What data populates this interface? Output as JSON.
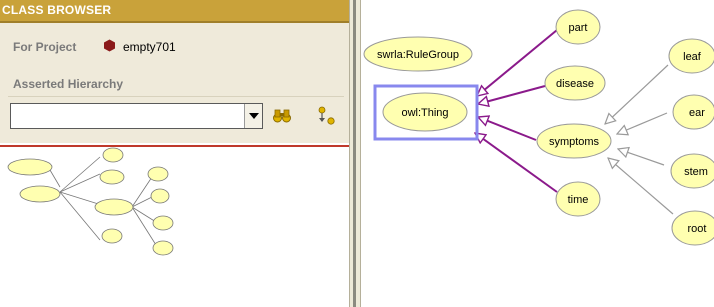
{
  "class_browser": {
    "title": "CLASS BROWSER",
    "project_label": "For Project",
    "project_name": "empty701",
    "hierarchy_label": "Asserted Hierarchy",
    "search": {
      "value": "",
      "placeholder": ""
    }
  },
  "graph": {
    "nodes": [
      {
        "id": "rulegroup",
        "label": "swrla:RuleGroup"
      },
      {
        "id": "thing",
        "label": "owl:Thing",
        "selected": true
      },
      {
        "id": "part",
        "label": "part"
      },
      {
        "id": "disease",
        "label": "disease"
      },
      {
        "id": "symptoms",
        "label": "symptoms"
      },
      {
        "id": "time",
        "label": "time"
      },
      {
        "id": "leaf",
        "label": "leaf"
      },
      {
        "id": "ear",
        "label": "ear"
      },
      {
        "id": "stem",
        "label": "stem"
      },
      {
        "id": "root",
        "label": "root"
      }
    ],
    "edges": [
      {
        "from": "part",
        "to": "thing",
        "style": "primary"
      },
      {
        "from": "disease",
        "to": "thing",
        "style": "primary"
      },
      {
        "from": "symptoms",
        "to": "thing",
        "style": "primary"
      },
      {
        "from": "time",
        "to": "thing",
        "style": "primary"
      },
      {
        "from": "leaf",
        "to": "symptoms",
        "style": "secondary"
      },
      {
        "from": "ear",
        "to": "symptoms",
        "style": "secondary"
      },
      {
        "from": "stem",
        "to": "symptoms",
        "style": "secondary"
      },
      {
        "from": "root",
        "to": "symptoms",
        "style": "secondary"
      }
    ]
  },
  "colors": {
    "header": "#c9a23a",
    "panel_background": "#efeada",
    "node_fill": "#ffffb0",
    "primary_edge": "#8b1a8b",
    "secondary_edge": "#9a9a9a",
    "selection": "#8888ee",
    "separator": "#c0392b",
    "project_icon": "#8b1a1a"
  }
}
